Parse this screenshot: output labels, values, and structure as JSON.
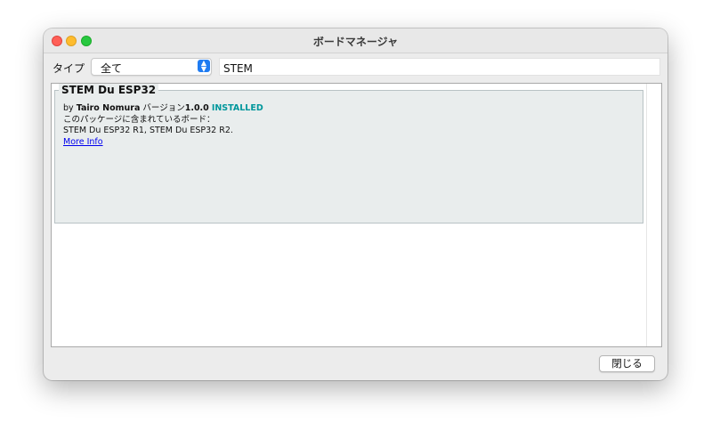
{
  "window": {
    "title": "ボードマネージャ"
  },
  "filter": {
    "type_label": "タイプ",
    "type_selected": "全て",
    "search_value": "STEM"
  },
  "packages": [
    {
      "name": "STEM Du ESP32",
      "by_label": "by",
      "author": "Tairo Nomura",
      "version_label": "バージョン",
      "version": "1.0.0",
      "status": "INSTALLED",
      "boards_label": "このパッケージに含まれているボード：",
      "boards": "STEM Du ESP32 R1, STEM Du ESP32 R2.",
      "more_info": "More Info"
    }
  ],
  "footer": {
    "close_label": "閉じる"
  },
  "colors": {
    "installed": "#00979c",
    "link": "#0000ee",
    "select_accent": "#1f7cf2"
  }
}
